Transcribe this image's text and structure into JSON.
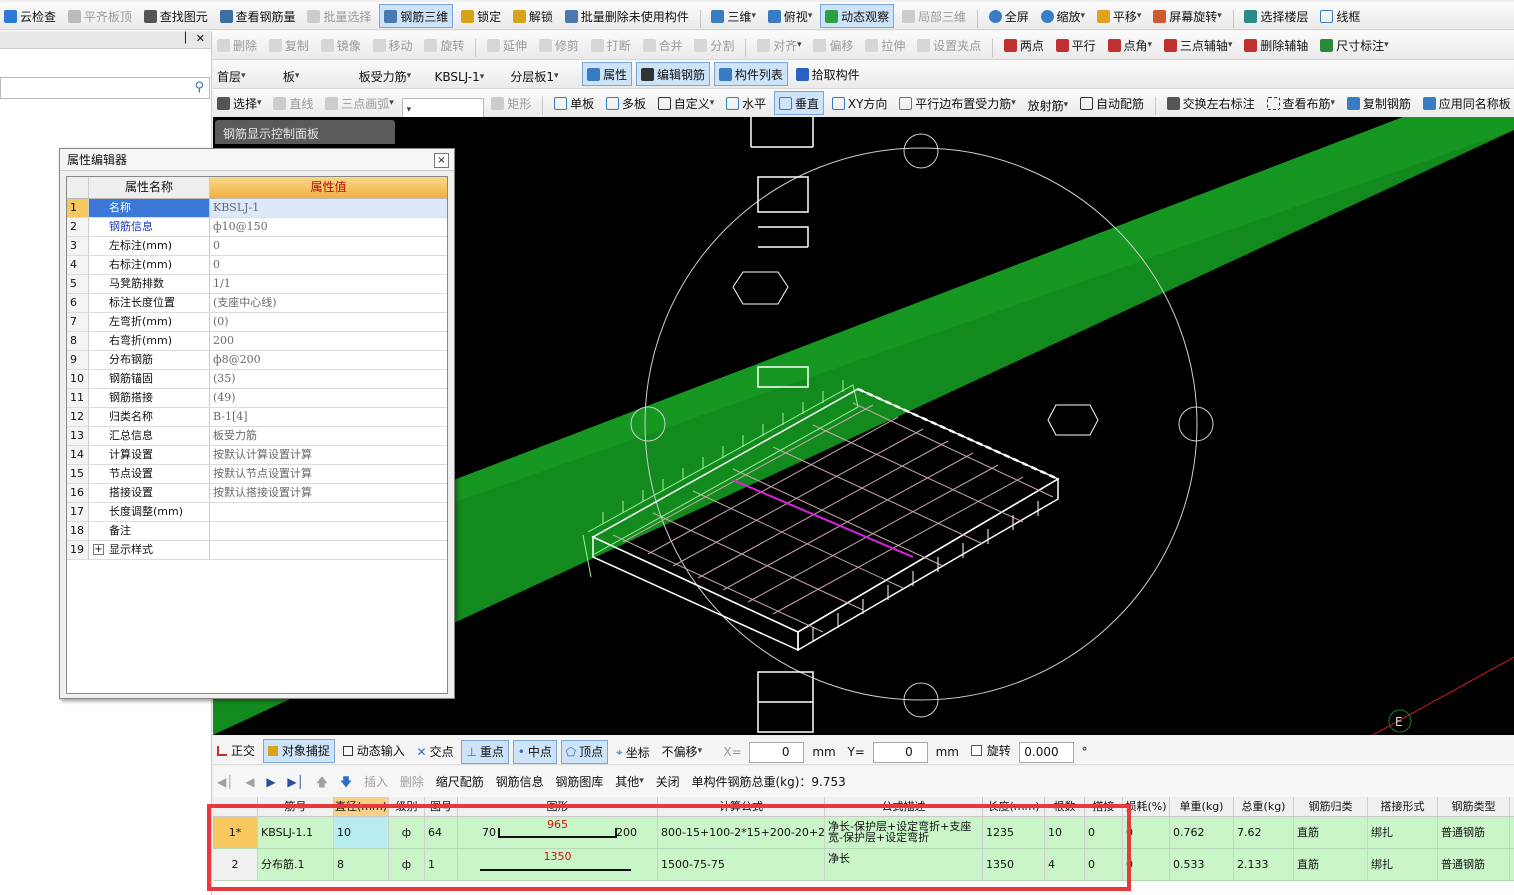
{
  "toolbar1": {
    "items": [
      "云检查",
      "平齐板顶",
      "查找图元",
      "查看钢筋量",
      "批量选择",
      "钢筋三维",
      "锁定",
      "解锁",
      "批量删除未使用构件",
      "三维",
      "俯视",
      "动态观察",
      "局部三维",
      "全屏",
      "缩放",
      "平移",
      "屏幕旋转",
      "选择楼层",
      "线框"
    ]
  },
  "toolbar2": {
    "items": [
      "删除",
      "复制",
      "镜像",
      "移动",
      "旋转",
      "延伸",
      "修剪",
      "打断",
      "合并",
      "分割",
      "对齐",
      "偏移",
      "拉伸",
      "设置夹点",
      "两点",
      "平行",
      "点角",
      "三点辅轴",
      "删除辅轴",
      "尺寸标注"
    ]
  },
  "toolbar3": {
    "floor": "首层",
    "category": "板",
    "subtype": "板受力筋",
    "component": "KBSLJ-1",
    "layer": "分层板1",
    "items": [
      "属性",
      "编辑钢筋",
      "构件列表",
      "拾取构件"
    ]
  },
  "toolbar4": {
    "items": [
      "选择",
      "直线",
      "三点画弧",
      "",
      "矩形",
      "单板",
      "多板",
      "自定义",
      "水平",
      "垂直",
      "XY方向",
      "平行边布置受力筋",
      "放射筋",
      "自动配筋",
      "交换左右标注",
      "查看布筋",
      "复制钢筋",
      "应用同名称板"
    ]
  },
  "viewport": {
    "panel_tab": "钢筋显示控制面板",
    "label_e": "E"
  },
  "prop_editor": {
    "title": "属性编辑器",
    "close": "×",
    "col_name": "属性名称",
    "col_value": "属性值",
    "rows": [
      {
        "n": "1",
        "name": "名称",
        "value": "KBSLJ-1",
        "blue": true
      },
      {
        "n": "2",
        "name": "钢筋信息",
        "value": "ф10@150",
        "blue": true
      },
      {
        "n": "3",
        "name": "左标注(mm)",
        "value": "0",
        "blue": false
      },
      {
        "n": "4",
        "name": "右标注(mm)",
        "value": "0",
        "blue": false
      },
      {
        "n": "5",
        "name": "马凳筋排数",
        "value": "1/1",
        "blue": false
      },
      {
        "n": "6",
        "name": "标注长度位置",
        "value": "(支座中心线)",
        "blue": false
      },
      {
        "n": "7",
        "name": "左弯折(mm)",
        "value": "(0)",
        "blue": false
      },
      {
        "n": "8",
        "name": "右弯折(mm)",
        "value": "200",
        "blue": false
      },
      {
        "n": "9",
        "name": "分布钢筋",
        "value": "ф8@200",
        "blue": false
      },
      {
        "n": "10",
        "name": "钢筋锚固",
        "value": "(35)",
        "blue": false
      },
      {
        "n": "11",
        "name": "钢筋搭接",
        "value": "(49)",
        "blue": false
      },
      {
        "n": "12",
        "name": "归类名称",
        "value": "B-1[4]",
        "blue": false
      },
      {
        "n": "13",
        "name": "汇总信息",
        "value": "板受力筋",
        "blue": false
      },
      {
        "n": "14",
        "name": "计算设置",
        "value": "按默认计算设置计算",
        "blue": false
      },
      {
        "n": "15",
        "name": "节点设置",
        "value": "按默认节点设置计算",
        "blue": false
      },
      {
        "n": "16",
        "name": "搭接设置",
        "value": "按默认搭接设置计算",
        "blue": false
      },
      {
        "n": "17",
        "name": "长度调整(mm)",
        "value": "",
        "blue": false
      },
      {
        "n": "18",
        "name": "备注",
        "value": "",
        "blue": false
      },
      {
        "n": "19",
        "name": "显示样式",
        "value": "",
        "blue": false
      }
    ]
  },
  "snapbar": {
    "items": [
      "正交",
      "对象捕捉",
      "动态输入",
      "交点",
      "重点",
      "中点",
      "顶点",
      "坐标"
    ],
    "offset_mode": "不偏移",
    "x_label": "X=",
    "x_value": "0",
    "y_label": "Y=",
    "y_value": "0",
    "unit": "mm",
    "rotate_label": "旋转",
    "rotate_value": "0.000",
    "degree": "°"
  },
  "navbar": {
    "items": [
      "插入",
      "删除",
      "缩尺配筋",
      "钢筋信息",
      "钢筋图库",
      "其他",
      "关闭"
    ],
    "total_weight": "单构件钢筋总重(kg)：9.753"
  },
  "grid": {
    "headers": [
      "",
      "筋号",
      "直径(mm)",
      "级别",
      "图号",
      "图形",
      "计算公式",
      "公式描述",
      "长度(mm)",
      "根数",
      "搭接",
      "损耗(%)",
      "单重(kg)",
      "总重(kg)",
      "钢筋归类",
      "搭接形式",
      "钢筋类型"
    ],
    "rows": [
      {
        "idx": "1*",
        "name": "KBSLJ-1.1",
        "dia": "10",
        "grade": "ф",
        "fig": "64",
        "shape_left": "70",
        "shape_mid": "965",
        "shape_right": "200",
        "formula": "800-15+100-2*15+200-20+200",
        "desc": "净长-保护层+设定弯折+支座宽-保护层+设定弯折",
        "len": "1235",
        "count": "10",
        "lap": "0",
        "loss": "0",
        "unit_w": "0.762",
        "total_w": "7.62",
        "cls": "直筋",
        "lap_form": "绑扎",
        "type": "普通钢筋"
      },
      {
        "idx": "2",
        "name": "分布筋.1",
        "dia": "8",
        "grade": "ф",
        "fig": "1",
        "shape_left": "",
        "shape_mid": "1350",
        "shape_right": "",
        "formula": "1500-75-75",
        "desc": "净长",
        "len": "1350",
        "count": "4",
        "lap": "0",
        "loss": "0",
        "unit_w": "0.533",
        "total_w": "2.133",
        "cls": "直筋",
        "lap_form": "绑扎",
        "type": "普通钢筋"
      }
    ]
  }
}
